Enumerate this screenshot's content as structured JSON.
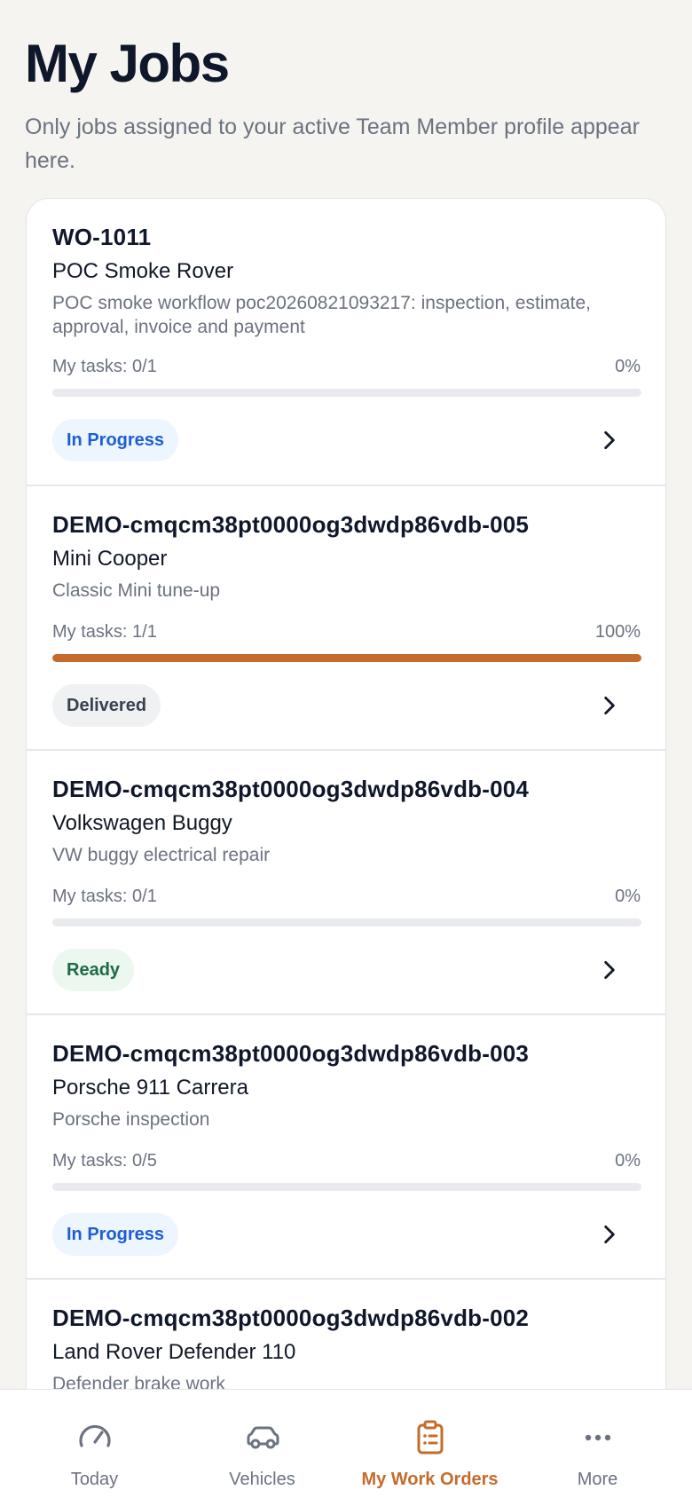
{
  "header": {
    "title": "My Jobs",
    "subtitle": "Only jobs assigned to your active Team Member profile appear here."
  },
  "jobs": [
    {
      "id": "WO-1011",
      "vehicle": "POC Smoke Rover",
      "description": "POC smoke workflow poc20260821093217: inspection, estimate, approval, invoice and payment",
      "tasks": "My tasks: 0/1",
      "percent_label": "0%",
      "progress": 0,
      "status": "In Progress"
    },
    {
      "id": "DEMO-cmqcm38pt0000og3dwdp86vdb-005",
      "vehicle": "Mini Cooper",
      "description": "Classic Mini tune-up",
      "tasks": "My tasks: 1/1",
      "percent_label": "100%",
      "progress": 100,
      "status": "Delivered"
    },
    {
      "id": "DEMO-cmqcm38pt0000og3dwdp86vdb-004",
      "vehicle": "Volkswagen Buggy",
      "description": "VW buggy electrical repair",
      "tasks": "My tasks: 0/1",
      "percent_label": "0%",
      "progress": 0,
      "status": "Ready"
    },
    {
      "id": "DEMO-cmqcm38pt0000og3dwdp86vdb-003",
      "vehicle": "Porsche 911 Carrera",
      "description": "Porsche inspection",
      "tasks": "My tasks: 0/5",
      "percent_label": "0%",
      "progress": 0,
      "status": "In Progress"
    },
    {
      "id": "DEMO-cmqcm38pt0000og3dwdp86vdb-002",
      "vehicle": "Land Rover Defender 110",
      "description": "Defender brake work"
    }
  ],
  "tabs": [
    {
      "label": "Today",
      "icon": "gauge-icon"
    },
    {
      "label": "Vehicles",
      "icon": "car-icon"
    },
    {
      "label": "My Work Orders",
      "icon": "clipboard-icon",
      "active": true
    },
    {
      "label": "More",
      "icon": "more-icon"
    }
  ],
  "colors": {
    "accent": "#c56c2c",
    "in_progress_text": "#1d5fd1",
    "ready_text": "#1b6b43",
    "delivered_text": "#374151"
  }
}
